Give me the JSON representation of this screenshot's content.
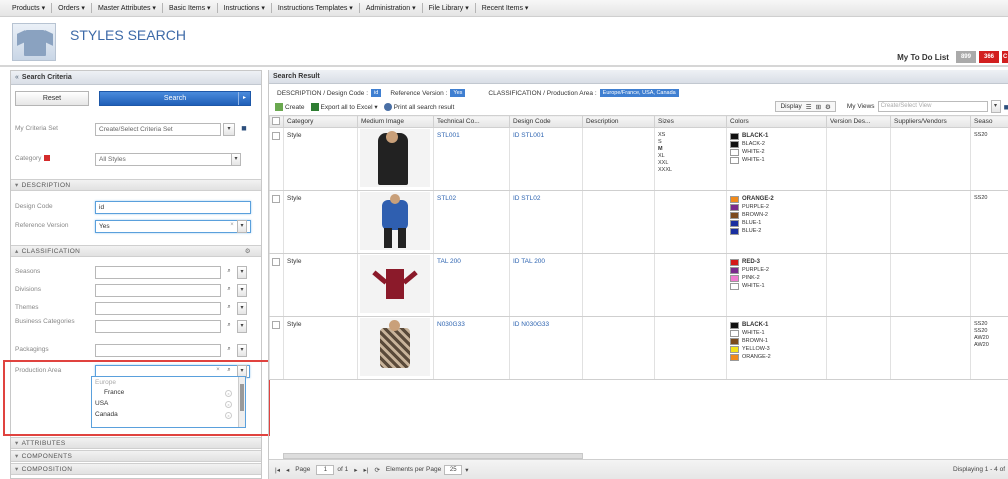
{
  "nav": [
    "Products ▾",
    "Orders ▾",
    "Master Attributes ▾",
    "Basic Items ▾",
    "Instructions ▾",
    "Instructions Templates ▾",
    "Administration ▾",
    "File Library ▾",
    "Recent Items ▾"
  ],
  "header": {
    "title": "STYLES SEARCH",
    "todo_label": "My To Do List",
    "badge_gray": "899",
    "badge_red": "366"
  },
  "left": {
    "title": "Search Criteria",
    "reset": "Reset",
    "search": "Search",
    "criteria_set_label": "My Criteria Set",
    "criteria_set_placeholder": "Create/Select Criteria Set",
    "category_label": "Category",
    "category_value": "All Styles",
    "sections": {
      "description": "DESCRIPTION",
      "classification": "CLASSIFICATION",
      "attributes": "ATTRIBUTES",
      "components": "COMPONENTS",
      "composition": "COMPOSITION"
    },
    "design_code_label": "Design Code",
    "design_code_value": "id",
    "ref_version_label": "Reference Version",
    "ref_version_value": "Yes",
    "class_fields": [
      "Seasons",
      "Divisions",
      "Themes",
      "Business Categories",
      "Packagings"
    ],
    "prod_area_label": "Production Area",
    "prod_area_options": [
      "Europe",
      "France",
      "USA",
      "Canada"
    ]
  },
  "right": {
    "title": "Search Result",
    "crit_desc": "DESCRIPTION / Design Code :",
    "crit_desc_chip": "id",
    "crit_ref": "Reference Version :",
    "crit_ref_chip": "Yes",
    "crit_class": "CLASSIFICATION / Production Area :",
    "crit_class_chip": "Europe/France, USA, Canada",
    "tb_create": "Create",
    "tb_export": "Export all to Excel ▾",
    "tb_print": "Print all search result",
    "tb_display": "Display",
    "tb_myviews": "My Views",
    "tb_views_placeholder": "Create/Select View",
    "columns": [
      "",
      "Category",
      "Medium Image",
      "Technical Co...",
      "Design Code",
      "Description",
      "Sizes",
      "Colors",
      "Version Des...",
      "Suppliers/Vendors",
      "Seaso"
    ],
    "rows": [
      {
        "category": "Style",
        "tech": "STL001",
        "design": "ID STL001",
        "sizes": [
          "XS",
          "S",
          "M",
          "XL",
          "XXL",
          "XXXL"
        ],
        "bold_size": 2,
        "colors": [
          {
            "name": "BLACK-1",
            "hex": "#111111",
            "bold": true
          },
          {
            "name": "BLACK-2",
            "hex": "#111111"
          },
          {
            "name": "WHITE-2",
            "hex": "#ffffff"
          },
          {
            "name": "WHITE-1",
            "hex": "#ffffff"
          }
        ],
        "season": [
          "SS20"
        ]
      },
      {
        "category": "Style",
        "tech": "STL02",
        "design": "ID STL02",
        "sizes": [],
        "bold_size": -1,
        "colors": [
          {
            "name": "ORANGE-2",
            "hex": "#f08a1c",
            "bold": true
          },
          {
            "name": "PURPLE-2",
            "hex": "#7a2a8c"
          },
          {
            "name": "BROWN-2",
            "hex": "#7b4a1e"
          },
          {
            "name": "BLUE-1",
            "hex": "#1a2fa0"
          },
          {
            "name": "BLUE-2",
            "hex": "#1a2fa0"
          }
        ],
        "season": [
          "SS20"
        ]
      },
      {
        "category": "Style",
        "tech": "TAL 200",
        "design": "ID TAL 200",
        "sizes": [],
        "bold_size": -1,
        "colors": [
          {
            "name": "RED-3",
            "hex": "#d41818",
            "bold": true
          },
          {
            "name": "PURPLE-2",
            "hex": "#7a2a8c"
          },
          {
            "name": "PINK-2",
            "hex": "#f07bd0"
          },
          {
            "name": "WHITE-1",
            "hex": "#ffffff"
          }
        ],
        "season": []
      },
      {
        "category": "Style",
        "tech": "N030G33",
        "design": "ID N030G33",
        "sizes": [],
        "bold_size": -1,
        "colors": [
          {
            "name": "BLACK-1",
            "hex": "#111111",
            "bold": true
          },
          {
            "name": "WHITE-1",
            "hex": "#ffffff"
          },
          {
            "name": "BROWN-1",
            "hex": "#7b4a1e"
          },
          {
            "name": "YELLOW-3",
            "hex": "#f4e21a"
          },
          {
            "name": "ORANGE-2",
            "hex": "#f08a1c"
          }
        ],
        "season": [
          "SS20",
          "SS20",
          "AW20",
          "AW20"
        ]
      }
    ],
    "footer_page": "Page",
    "footer_page_value": "1",
    "footer_of": "of 1",
    "footer_epp": "Elements per Page",
    "footer_epp_value": "25",
    "footer_display": "Displaying 1 - 4 of"
  }
}
